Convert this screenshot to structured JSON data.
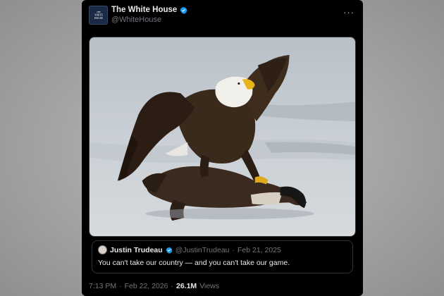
{
  "post": {
    "author": {
      "display_name": "The White House",
      "handle": "@WhiteHouse",
      "verified": true,
      "avatar_icon": "white-house-logo-icon",
      "avatar_text": "THE WHITE HOUSE"
    },
    "more_label": "···",
    "image": {
      "subject_icon": "eagle-on-goose-image"
    },
    "quote": {
      "author": {
        "display_name": "Justin Trudeau",
        "handle": "@JustinTrudeau",
        "verified": true
      },
      "separator": "·",
      "date": "Feb 21, 2025",
      "text": "You can't take our country — and you can't take our game."
    },
    "meta": {
      "time": "7:13 PM",
      "separator1": "·",
      "date": "Feb 22, 2026",
      "separator2": "·",
      "views_count": "26.1M",
      "views_label": "Views"
    }
  },
  "colors": {
    "background": "#000000",
    "text_primary": "#e7e9ea",
    "text_secondary": "#71767b",
    "verified_blue": "#1d9bf0",
    "border": "#2f3336"
  }
}
